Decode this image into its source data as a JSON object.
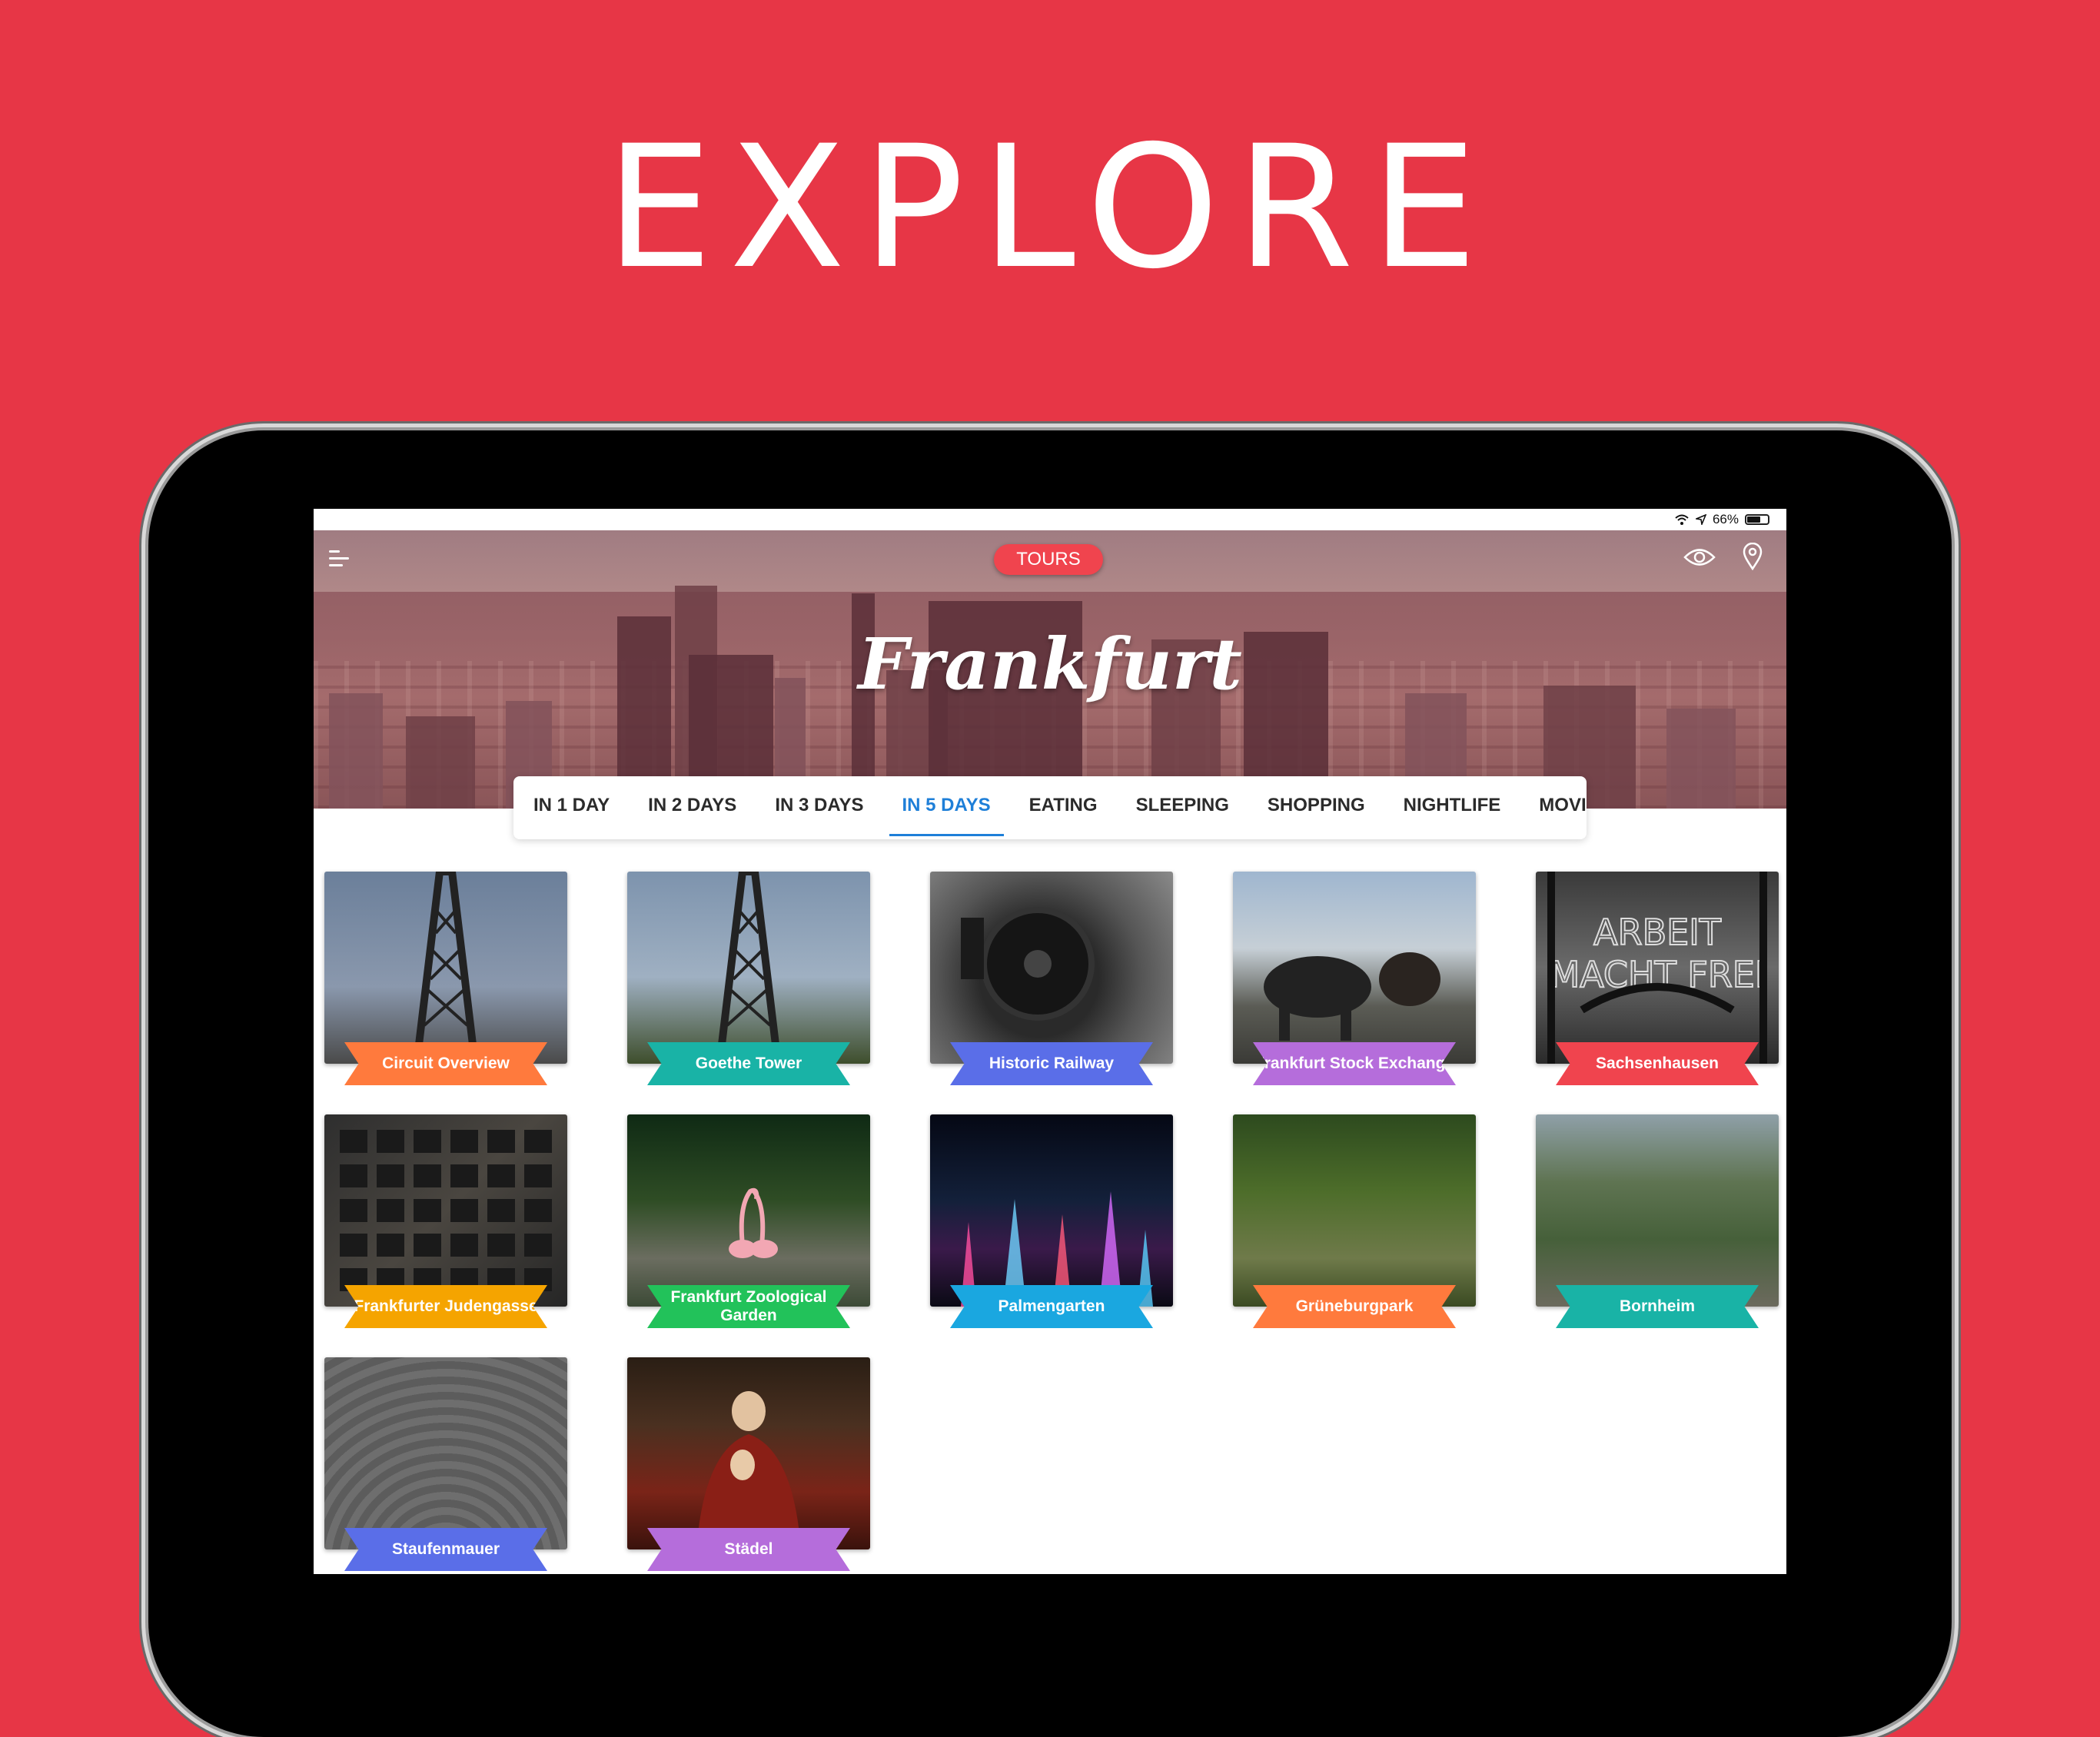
{
  "headline": "EXPLORE",
  "status": {
    "battery_label": "66%",
    "battery_level": 0.66
  },
  "header": {
    "tours_label": "TOURS",
    "city_title": "Frankfurt"
  },
  "tabs": [
    {
      "label": "IN 1 DAY",
      "active": false
    },
    {
      "label": "IN 2 DAYS",
      "active": false
    },
    {
      "label": "IN 3 DAYS",
      "active": false
    },
    {
      "label": "IN 5 DAYS",
      "active": true
    },
    {
      "label": "EATING",
      "active": false
    },
    {
      "label": "SLEEPING",
      "active": false
    },
    {
      "label": "SHOPPING",
      "active": false
    },
    {
      "label": "NIGHTLIFE",
      "active": false
    },
    {
      "label": "MOVING AROUND",
      "active": false
    }
  ],
  "places": [
    {
      "label": "Circuit Overview",
      "ribbon": "#ff7a3d",
      "scene": "tower"
    },
    {
      "label": "Goethe Tower",
      "ribbon": "#19b3a6",
      "scene": "tower2"
    },
    {
      "label": "Historic Railway",
      "ribbon": "#5a6ee8",
      "scene": "train"
    },
    {
      "label": "Frankfurt Stock Exchange",
      "ribbon": "#b56ddb",
      "scene": "bull"
    },
    {
      "label": "Sachsenhausen",
      "ribbon": "#f0444e",
      "scene": "gate"
    },
    {
      "label": "Frankfurter Judengasse",
      "ribbon": "#f5a400",
      "scene": "wall"
    },
    {
      "label": "Frankfurt Zoological Garden",
      "ribbon": "#22c25a",
      "scene": "zoo"
    },
    {
      "label": "Palmengarten",
      "ribbon": "#1aa7e0",
      "scene": "fountain"
    },
    {
      "label": "Grüneburgpark",
      "ribbon": "#ff7a3d",
      "scene": "park"
    },
    {
      "label": "Bornheim",
      "ribbon": "#19b3a6",
      "scene": "town"
    },
    {
      "label": "Staufenmauer",
      "ribbon": "#5a6ee8",
      "scene": "stone"
    },
    {
      "label": "Städel",
      "ribbon": "#b56ddb",
      "scene": "painting"
    }
  ]
}
